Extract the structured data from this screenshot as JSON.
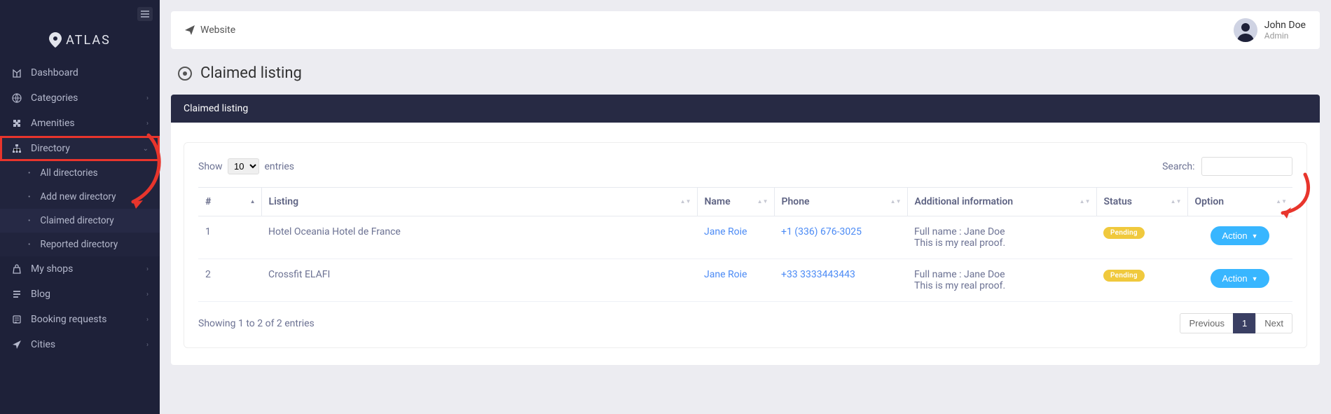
{
  "brand": "ATLAS",
  "topbar": {
    "website_label": "Website"
  },
  "user": {
    "name": "John Doe",
    "role": "Admin"
  },
  "sidebar": {
    "items": [
      {
        "label": "Dashboard"
      },
      {
        "label": "Categories"
      },
      {
        "label": "Amenities"
      },
      {
        "label": "Directory"
      },
      {
        "label": "My shops"
      },
      {
        "label": "Blog"
      },
      {
        "label": "Booking requests"
      },
      {
        "label": "Cities"
      }
    ],
    "directory_submenu": [
      {
        "label": "All directories"
      },
      {
        "label": "Add new directory"
      },
      {
        "label": "Claimed directory"
      },
      {
        "label": "Reported directory"
      }
    ]
  },
  "page": {
    "title": "Claimed listing",
    "panel_title": "Claimed listing"
  },
  "table": {
    "show_label": "Show",
    "entries_label": "entries",
    "page_size": "10",
    "search_label": "Search:",
    "columns": {
      "idx": "#",
      "listing": "Listing",
      "name": "Name",
      "phone": "Phone",
      "info": "Additional information",
      "status": "Status",
      "option": "Option"
    },
    "rows": [
      {
        "idx": "1",
        "listing": "Hotel Oceania Hotel de France",
        "name": "Jane Roie",
        "phone": "+1 (336) 676-3025",
        "info_line1": "Full name : Jane Doe",
        "info_line2": "This is my real proof.",
        "status": "Pending",
        "action": "Action"
      },
      {
        "idx": "2",
        "listing": "Crossfit ELAFI",
        "name": "Jane Roie",
        "phone": "+33 3333443443",
        "info_line1": "Full name : Jane Doe",
        "info_line2": "This is my real proof.",
        "status": "Pending",
        "action": "Action"
      }
    ],
    "info_text": "Showing 1 to 2 of 2 entries",
    "pagination": {
      "prev": "Previous",
      "page": "1",
      "next": "Next"
    }
  }
}
